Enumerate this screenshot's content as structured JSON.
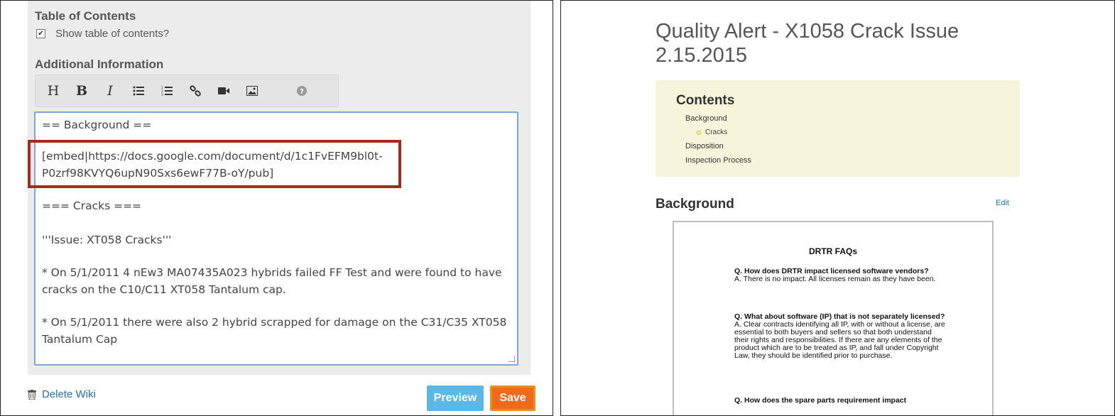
{
  "editor": {
    "toc_section_title": "Table of Contents",
    "toc_checkbox_label": "Show table of contents?",
    "toc_checkbox_checked": true,
    "additional_info_title": "Additional Information",
    "toolbar": {
      "heading": "H",
      "bold": "B",
      "italic": "I",
      "icons": [
        "bulleted-list-icon",
        "numbered-list-icon",
        "link-icon",
        "video-icon",
        "image-icon",
        "help-icon"
      ]
    },
    "lines": [
      "== Background ==",
      "[embed|https://docs.google.com/document/d/1c1FvEFM9bl0t-",
      "P0zrf98KVYQ6upN90Sxs6ewF77B-oY/pub]",
      "=== Cracks ===",
      "'''Issue: XT058 Cracks'''",
      "* On 5/1/2011 4 nEw3 MA07435A023 hybrids failed FF Test and were found to have",
      "cracks on the C10/C11 XT058 Tantalum cap.",
      "* On 5/1/2011 there were also 2 hybrid scrapped for damage on the C31/C35 XT058",
      "Tantalum Cap"
    ],
    "delete_link": "Delete Wiki",
    "preview_button": "Preview",
    "save_button": "Save",
    "highlight_color": "#a8281e"
  },
  "preview": {
    "title": "Quality Alert - X1058 Crack Issue 2.15.2015",
    "toc": {
      "title": "Contents",
      "item_background": "Background",
      "item_cracks": "Cracks",
      "item_disposition": "Disposition",
      "item_inspection": "Inspection Process"
    },
    "section_heading": "Background",
    "edit_link": "Edit",
    "embed": {
      "title": "DRTR FAQs",
      "faqs": [
        {
          "q": "Q. How does DRTR impact licensed software vendors?",
          "a": "A. There is no impact. All licenses remain as they have been."
        },
        {
          "q": "Q. What about software (IP) that is not separately licensed?",
          "a": "A.  Clear contracts identifying all IP, with or without a license, are essential to both buyers and sellers so that both understand their rights and responsibilities.  If there are any elements of the product which are to be treated as IP, and fall under Copyright Law, they should be identified prior to purchase."
        },
        {
          "q": "Q. How does the spare parts requirement impact",
          "a": ""
        }
      ]
    }
  }
}
